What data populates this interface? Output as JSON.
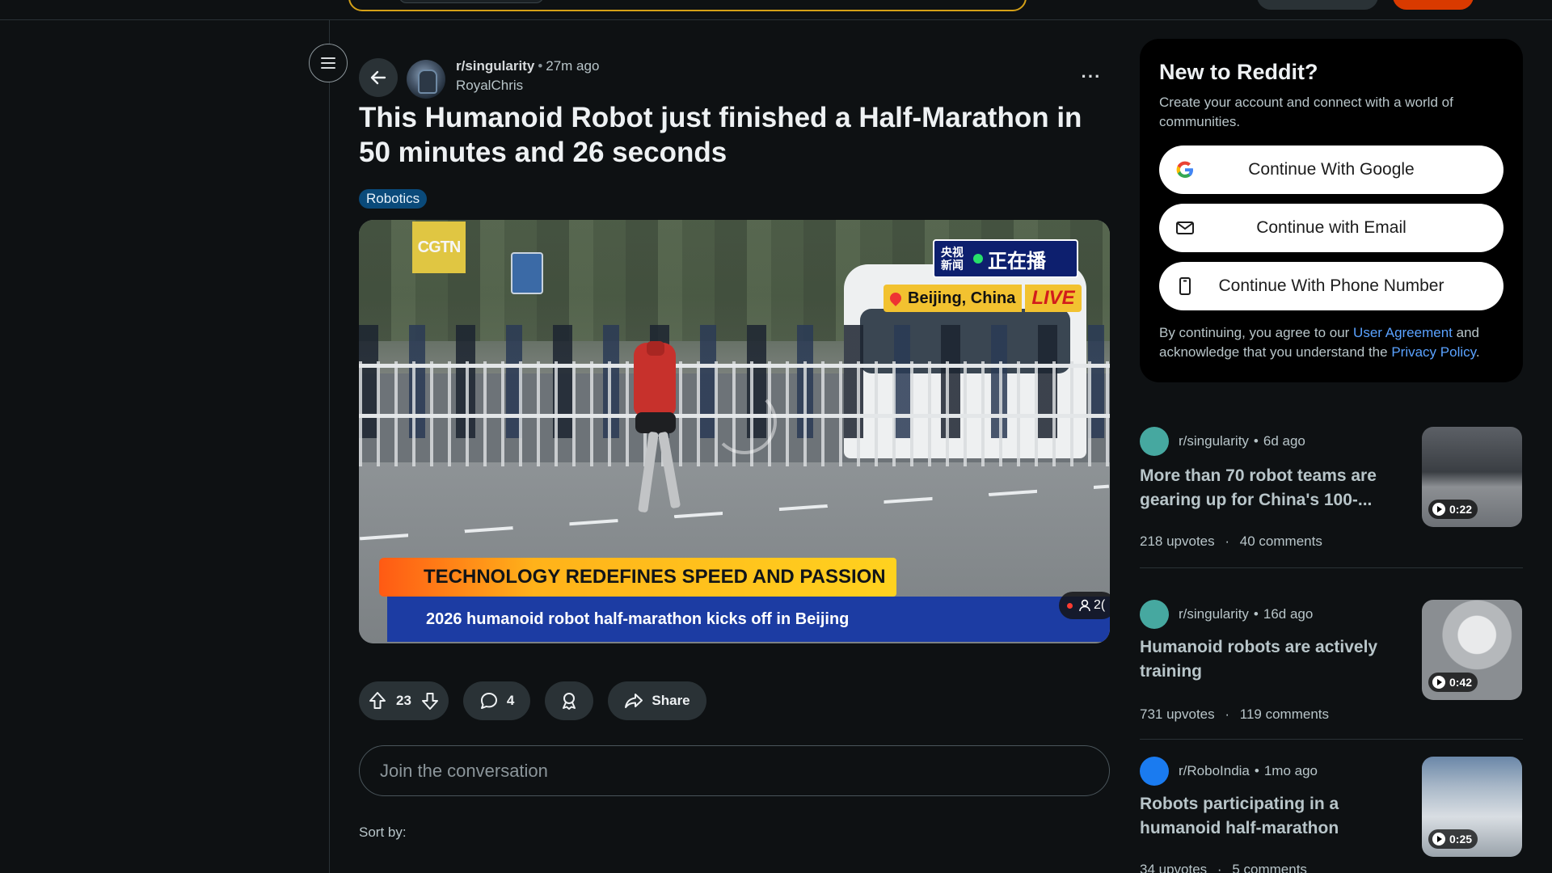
{
  "post": {
    "subreddit": "r/singularity",
    "time": "27m ago",
    "author": "RoyalChris",
    "title": "This Humanoid Robot just finished a Half-Marathon in 50 minutes and 26 seconds",
    "flair": "Robotics",
    "video": {
      "logo": "CGTN",
      "live_cn": "央视新闻",
      "live_cn2": "正在播",
      "location": "Beijing, China",
      "live": "LIVE",
      "headline": "TECHNOLOGY REDEFINES SPEED AND PASSION",
      "subheadline": "2026 humanoid robot half-marathon kicks off in Beijing",
      "viewers": "2("
    },
    "votes": "23",
    "comments": "4",
    "share_label": "Share",
    "comment_placeholder": "Join the conversation",
    "sort_label": "Sort by:",
    "more_label": "···"
  },
  "signup": {
    "title": "New to Reddit?",
    "subtitle": "Create your account and connect with a world of communities.",
    "google": "Continue With Google",
    "email": "Continue with Email",
    "phone": "Continue With Phone Number",
    "legal_pre": "By continuing, you agree to our ",
    "legal_link1": "User Agreement",
    "legal_mid": " and acknowledge that you understand the ",
    "legal_link2": "Privacy Policy",
    "legal_end": "."
  },
  "related": [
    {
      "subreddit": "r/singularity",
      "time": "6d ago",
      "title": "More than 70 robot teams are gearing up for China's 100-...",
      "upvotes": "218 upvotes",
      "comments": "40 comments",
      "duration": "0:22",
      "avatar_color": "#46a8a0"
    },
    {
      "subreddit": "r/singularity",
      "time": "16d ago",
      "title": "Humanoid robots are actively training",
      "upvotes": "731 upvotes",
      "comments": "119 comments",
      "duration": "0:42",
      "avatar_color": "#46a8a0"
    },
    {
      "subreddit": "r/RoboIndia",
      "time": "1mo ago",
      "title": "Robots participating in a humanoid half-marathon",
      "upvotes": "34 upvotes",
      "comments": "5 comments",
      "duration": "0:25",
      "avatar_color": "#1a7bf0"
    }
  ],
  "colors": {
    "background": "#0e1113",
    "accent_link": "#5aa2ff",
    "flair_bg": "#0a4a7a",
    "brand_orange": "#d93a00"
  }
}
